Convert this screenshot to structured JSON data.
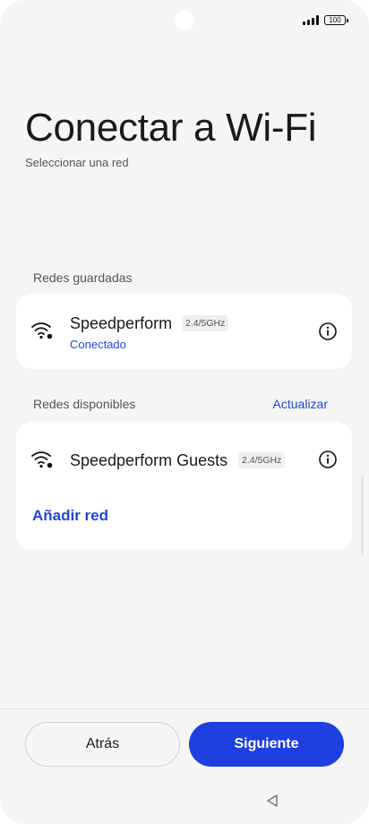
{
  "status_bar": {
    "battery": "100"
  },
  "header": {
    "title": "Conectar a Wi-Fi",
    "subtitle": "Seleccionar una red"
  },
  "saved": {
    "label": "Redes guardadas",
    "network": {
      "name": "Speedperform",
      "band": "2.4/5GHz",
      "status": "Conectado"
    }
  },
  "available": {
    "label": "Redes disponibles",
    "refresh_label": "Actualizar",
    "networks": [
      {
        "name": "Speedperform Guests",
        "band": "2.4/5GHz"
      }
    ],
    "add_label": "Añadir red"
  },
  "footer": {
    "back_label": "Atrás",
    "next_label": "Siguiente"
  },
  "icons": {
    "wifi": "wifi-icon",
    "info": "info-icon",
    "signal": "signal-icon",
    "battery": "battery-icon",
    "nav_back": "nav-back-icon"
  },
  "colors": {
    "accent": "#1f3fe0",
    "link": "#1f47d6",
    "background": "#f5f5f5",
    "card": "#ffffff"
  }
}
